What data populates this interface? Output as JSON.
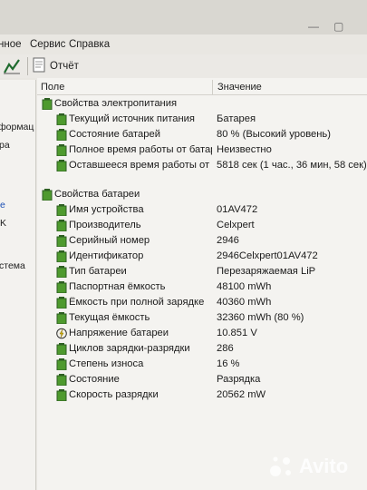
{
  "menu": {
    "item1": "нное",
    "item2": "Сервис",
    "item3": "Справка"
  },
  "toolbar": {
    "report_label": "Отчёт"
  },
  "left_pane": [
    "формац",
    "ра",
    "е",
    "K",
    "стема"
  ],
  "columns": {
    "field": "Поле",
    "value": "Значение"
  },
  "sections": [
    {
      "title": "Свойства электропитания",
      "rows": [
        {
          "label": "Текущий источник питания",
          "value": "Батарея",
          "icon": "battery-icon"
        },
        {
          "label": "Состояние батарей",
          "value": "80 % (Высокий уровень)",
          "icon": "battery-icon"
        },
        {
          "label": "Полное время работы от батар...",
          "value": "Неизвестно",
          "icon": "battery-icon"
        },
        {
          "label": "Оставшееся время работы от б...",
          "value": "5818 сек (1 час., 36 мин, 58 сек)",
          "icon": "battery-icon"
        }
      ]
    },
    {
      "title": "Свойства батареи",
      "rows": [
        {
          "label": "Имя устройства",
          "value": "01AV472",
          "icon": "battery-icon"
        },
        {
          "label": "Производитель",
          "value": "Celxpert",
          "icon": "battery-icon"
        },
        {
          "label": "Серийный номер",
          "value": "2946",
          "icon": "battery-icon"
        },
        {
          "label": "Идентификатор",
          "value": "2946Celxpert01AV472",
          "icon": "battery-icon"
        },
        {
          "label": "Тип батареи",
          "value": "Перезаряжаемая LiP",
          "icon": "battery-icon"
        },
        {
          "label": "Паспортная ёмкость",
          "value": "48100 mWh",
          "icon": "battery-icon"
        },
        {
          "label": "Ёмкость при полной зарядке",
          "value": "40360 mWh",
          "icon": "battery-icon"
        },
        {
          "label": "Текущая ёмкость",
          "value": "32360 mWh  (80 %)",
          "icon": "battery-icon"
        },
        {
          "label": "Напряжение батареи",
          "value": "10.851 V",
          "icon": "voltage-icon"
        },
        {
          "label": "Циклов зарядки-разрядки",
          "value": "286",
          "icon": "battery-icon"
        },
        {
          "label": "Степень износа",
          "value": "16 %",
          "icon": "battery-icon"
        },
        {
          "label": "Состояние",
          "value": "Разрядка",
          "icon": "battery-icon"
        },
        {
          "label": "Скорость разрядки",
          "value": "20562 mW",
          "icon": "battery-icon"
        }
      ]
    }
  ],
  "watermark": {
    "text": "Avito"
  }
}
